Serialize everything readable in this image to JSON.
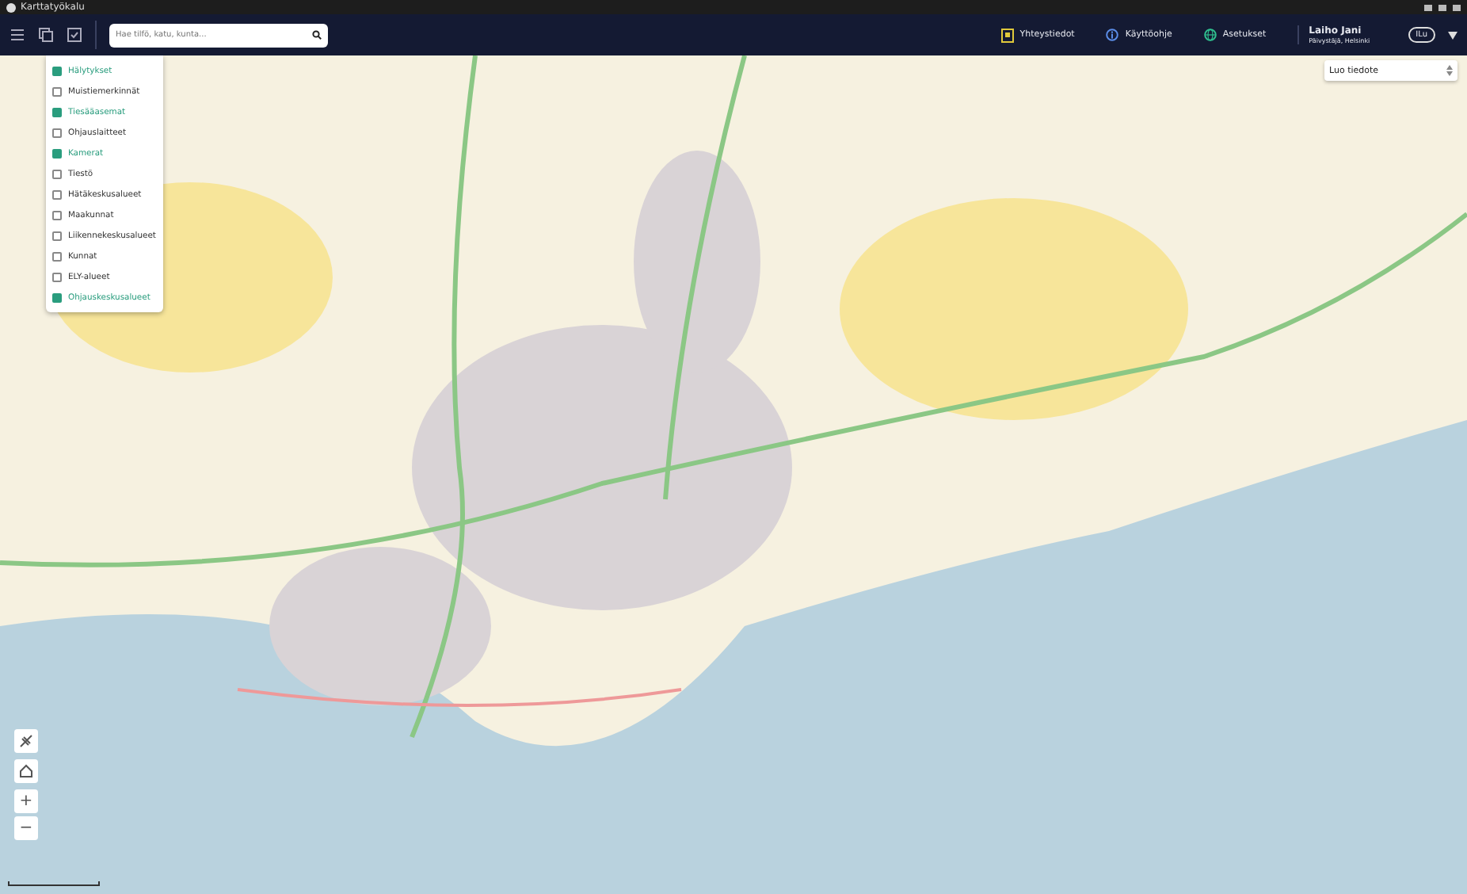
{
  "window": {
    "title": "Karttatyökalu"
  },
  "toolbar": {
    "search": {
      "placeholder": "Hae tilfö, katu, kunta..."
    }
  },
  "header_links": [
    {
      "label": "Yhteystiedot",
      "kind": "contacts"
    },
    {
      "label": "Käyttöohje",
      "kind": "info"
    },
    {
      "label": "Asetukset",
      "kind": "settings"
    }
  ],
  "user": {
    "name": "Laiho Jani",
    "role": "Päivystäjä, Helsinki",
    "badge": "ILu"
  },
  "create_select": {
    "value": "Luo tiedote"
  },
  "layers": [
    {
      "label": "Hälytykset",
      "checked": true
    },
    {
      "label": "Muistiemerkinnät",
      "checked": false
    },
    {
      "label": "Tiesääasemat",
      "checked": true
    },
    {
      "label": "Ohjauslaitteet",
      "checked": false
    },
    {
      "label": "Kamerat",
      "checked": true
    },
    {
      "label": "Tiestö",
      "checked": false
    },
    {
      "label": "Hätäkeskusalueet",
      "checked": false
    },
    {
      "label": "Maakunnat",
      "checked": false
    },
    {
      "label": "Liikennekeskusalueet",
      "checked": false
    },
    {
      "label": "Kunnat",
      "checked": false
    },
    {
      "label": "ELY-alueet",
      "checked": false
    },
    {
      "label": "Ohjauskeskusalueet",
      "checked": true
    }
  ],
  "map_controls": {
    "zoom_in": "+",
    "zoom_out": "−"
  }
}
